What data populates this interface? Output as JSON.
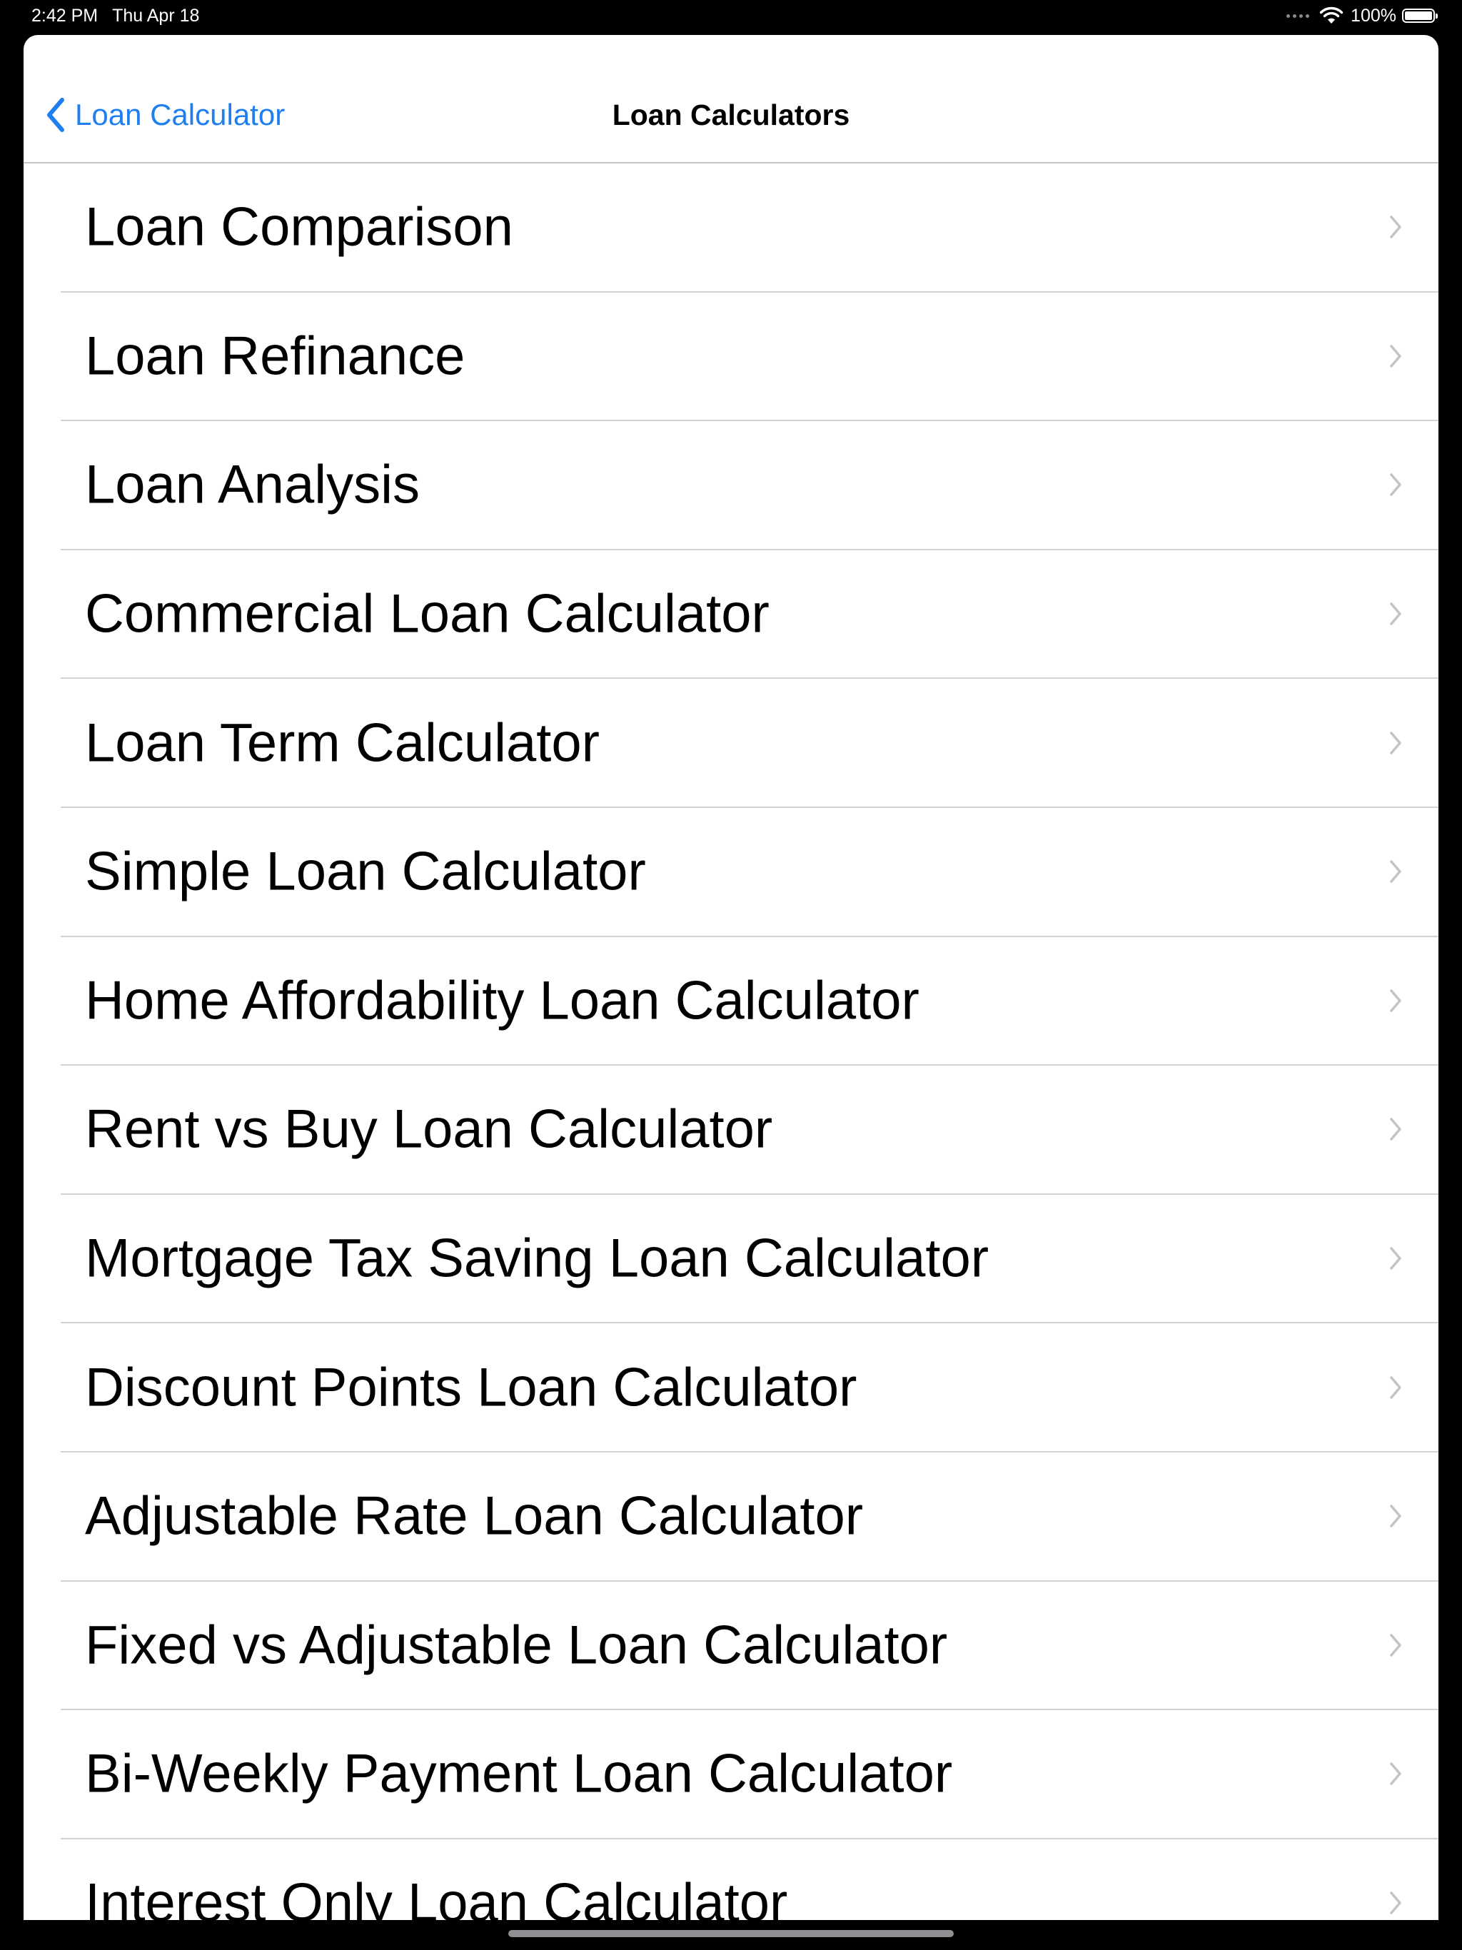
{
  "status_bar": {
    "time": "2:42 PM",
    "date": "Thu Apr 18",
    "battery": "100%"
  },
  "nav": {
    "back_label": "Loan Calculator",
    "title": "Loan Calculators"
  },
  "colors": {
    "accent": "#1f7ff0",
    "separator": "#d1d1d6",
    "chevron": "#c4c4c7"
  },
  "items": [
    {
      "label": "Loan Comparison"
    },
    {
      "label": "Loan Refinance"
    },
    {
      "label": "Loan Analysis"
    },
    {
      "label": "Commercial Loan Calculator"
    },
    {
      "label": "Loan Term Calculator"
    },
    {
      "label": "Simple Loan Calculator"
    },
    {
      "label": "Home Affordability Loan Calculator"
    },
    {
      "label": "Rent vs Buy Loan Calculator"
    },
    {
      "label": "Mortgage Tax Saving Loan Calculator"
    },
    {
      "label": "Discount Points Loan Calculator"
    },
    {
      "label": "Adjustable Rate Loan Calculator"
    },
    {
      "label": "Fixed vs Adjustable Loan Calculator"
    },
    {
      "label": "Bi-Weekly Payment Loan Calculator"
    },
    {
      "label": "Interest Only Loan Calculator"
    }
  ]
}
